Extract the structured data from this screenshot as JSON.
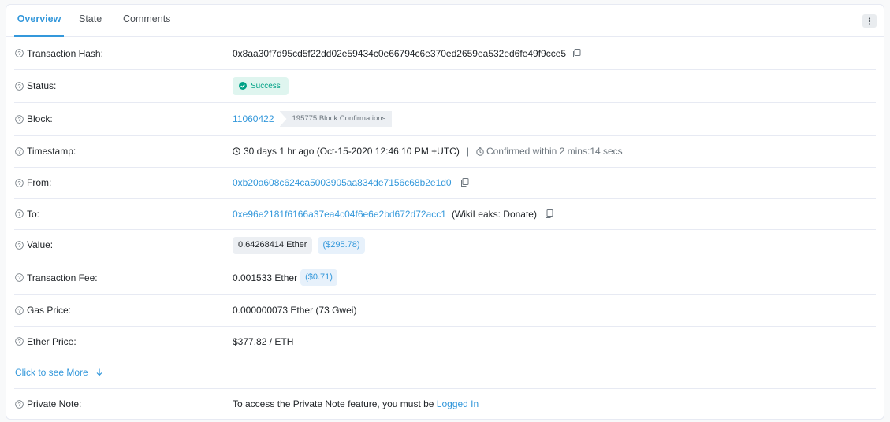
{
  "tabs": [
    {
      "label": "Overview",
      "active": true
    },
    {
      "label": "State",
      "active": false
    },
    {
      "label": "Comments",
      "active": false
    }
  ],
  "menu_icon": "vertical-dots-icon",
  "rows": {
    "tx_hash": {
      "label": "Transaction Hash:",
      "value": "0x8aa30f7d95cd5f22dd02e59434c0e66794c6e370ed2659ea532ed6fe49f9cce5"
    },
    "status": {
      "label": "Status:",
      "value": "Success"
    },
    "block": {
      "label": "Block:",
      "value": "11060422",
      "confirmations": "195775 Block Confirmations"
    },
    "timestamp": {
      "label": "Timestamp:",
      "value": "30 days 1 hr ago (Oct-15-2020 12:46:10 PM +UTC)",
      "separator": "|",
      "confirmed": "Confirmed within 2 mins:14 secs"
    },
    "from": {
      "label": "From:",
      "value": "0xb20a608c624ca5003905aa834de7156c68b2e1d0"
    },
    "to": {
      "label": "To:",
      "value": "0xe96e2181f6166a37ea4c04f6e6e2bd672d72acc1",
      "tag": "(WikiLeaks: Donate)"
    },
    "value": {
      "label": "Value:",
      "amount": "0.64268414 Ether",
      "usd": "($295.78)"
    },
    "tx_fee": {
      "label": "Transaction Fee:",
      "amount": "0.001533 Ether",
      "usd": "($0.71)"
    },
    "gas_price": {
      "label": "Gas Price:",
      "value": "0.000000073 Ether (73 Gwei)"
    },
    "ether_price": {
      "label": "Ether Price:",
      "value": "$377.82 / ETH"
    },
    "see_more": {
      "label": "Click to see More"
    },
    "private_note": {
      "label": "Private Note:",
      "text": "To access the Private Note feature, you must be ",
      "link": "Logged In"
    }
  },
  "colors": {
    "accent": "#3498db",
    "success": "#00a186",
    "success_bg": "#dff5ef",
    "border": "#e7eaf3"
  }
}
